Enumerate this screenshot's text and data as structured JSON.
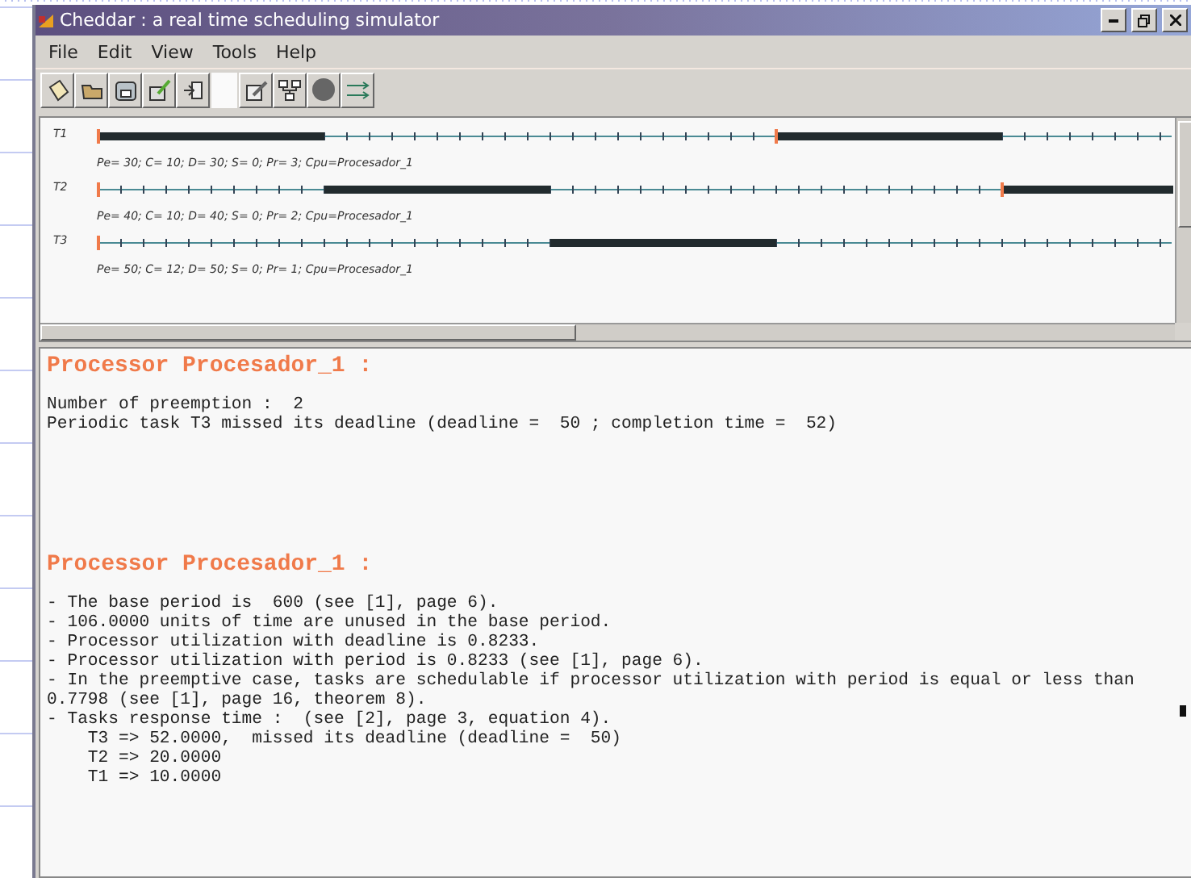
{
  "window": {
    "title": "Cheddar : a real time scheduling simulator"
  },
  "menu": [
    "File",
    "Edit",
    "View",
    "Tools",
    "Help"
  ],
  "toolbar": [
    {
      "kind": "page"
    },
    {
      "kind": "folder"
    },
    {
      "kind": "disk"
    },
    {
      "kind": "brush"
    },
    {
      "kind": "exit"
    },
    {
      "kind": "blank"
    },
    {
      "kind": "pencil"
    },
    {
      "kind": "network"
    },
    {
      "kind": "circle"
    },
    {
      "kind": "arrows"
    }
  ],
  "tasks": [
    {
      "name": "T1",
      "params": "Pe= 30; C= 10; D= 30; S= 0; Pr= 3; Cpu=Procesador_1"
    },
    {
      "name": "T2",
      "params": "Pe= 40; C= 10; D= 40; S= 0; Pr= 2; Cpu=Procesador_1"
    },
    {
      "name": "T3",
      "params": "Pe= 50; C= 12; D= 50; S= 0; Pr= 1; Cpu=Procesador_1"
    }
  ],
  "sections": [
    {
      "heading": "Processor Procesador_1 :",
      "lines": [
        "Number of preemption :  2",
        "Periodic task T3 missed its deadline (deadline =  50 ; completion time =  52)"
      ]
    },
    {
      "heading": "Processor Procesador_1 :",
      "lines": [
        "- The base period is  600 (see [1], page 6).",
        "- 106.0000 units of time are unused in the base period.",
        "- Processor utilization with deadline is 0.8233.",
        "- Processor utilization with period is 0.8233 (see [1], page 6).",
        "- In the preemptive case, tasks are schedulable if processor utilization with period is equal or less than",
        "0.7798 (see [1], page 16, theorem 8).",
        "- Tasks response time :  (see [2], page 3, equation 4).",
        "    T3 => 52.0000,  missed its deadline (deadline =  50)",
        "    T2 => 20.0000",
        "    T1 => 10.0000"
      ]
    }
  ]
}
